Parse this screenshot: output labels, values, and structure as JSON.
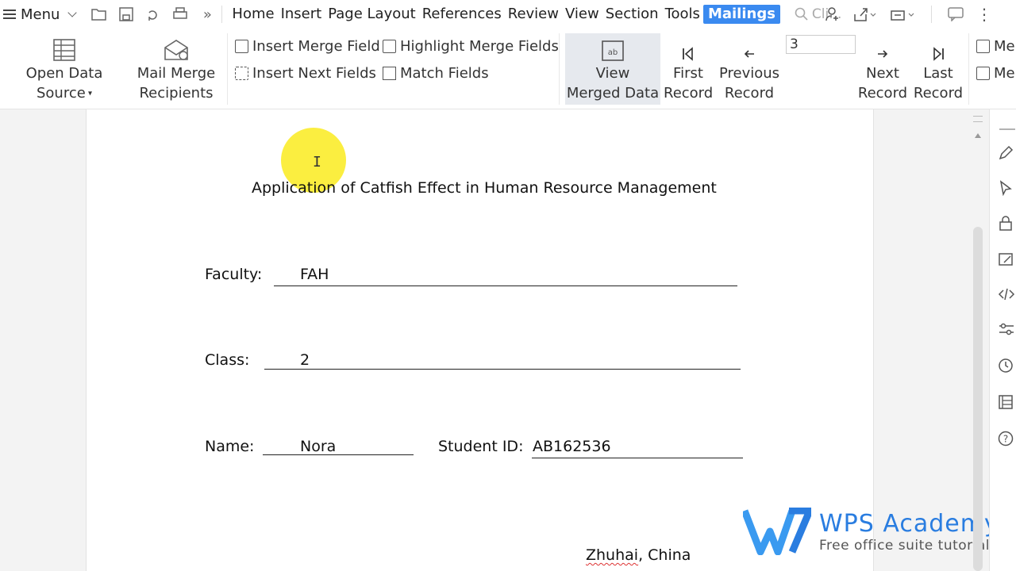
{
  "menubar": {
    "menu_label": "Menu",
    "tabs": [
      "Home",
      "Insert",
      "Page Layout",
      "References",
      "Review",
      "View",
      "Section",
      "Tools",
      "Mailings"
    ],
    "active_tab": "Mailings",
    "search_placeholder": "Cli..."
  },
  "ribbon": {
    "open_data_source": "Open Data Source",
    "mail_merge_recipients_line1": "Mail Merge",
    "mail_merge_recipients_line2": "Recipients",
    "insert_merge_field": "Insert Merge Field",
    "insert_next_fields": "Insert Next Fields",
    "highlight_merge_fields": "Highlight Merge Fields",
    "match_fields": "Match Fields",
    "view_merged_data_line1": "View",
    "view_merged_data_line2": "Merged Data",
    "first_record_line1": "First",
    "first_record_line2": "Record",
    "previous_record_line1": "Previous",
    "previous_record_line2": "Record",
    "record_number": "3",
    "next_record_line1": "Next",
    "next_record_line2": "Record",
    "last_record_line1": "Last",
    "last_record_line2": "Record",
    "cut_label_1": "Me",
    "cut_label_2": "Me"
  },
  "document": {
    "title": "Application of Catfish Effect in Human Resource Management",
    "faculty_label": "Faculty:",
    "faculty_value": "FAH",
    "class_label": "Class:",
    "class_value": "2",
    "name_label": "Name:",
    "name_value": "Nora",
    "student_id_label": "Student ID:",
    "student_id_value": "AB162536",
    "location_word1": "Zhuhai",
    "location_rest": ", China"
  },
  "watermark": {
    "title": "WPS Academy",
    "subtitle": "Free office suite tutorials"
  },
  "colors": {
    "accent": "#3a8af0",
    "highlight": "#faeb1e",
    "brand": "#2a7de0"
  }
}
